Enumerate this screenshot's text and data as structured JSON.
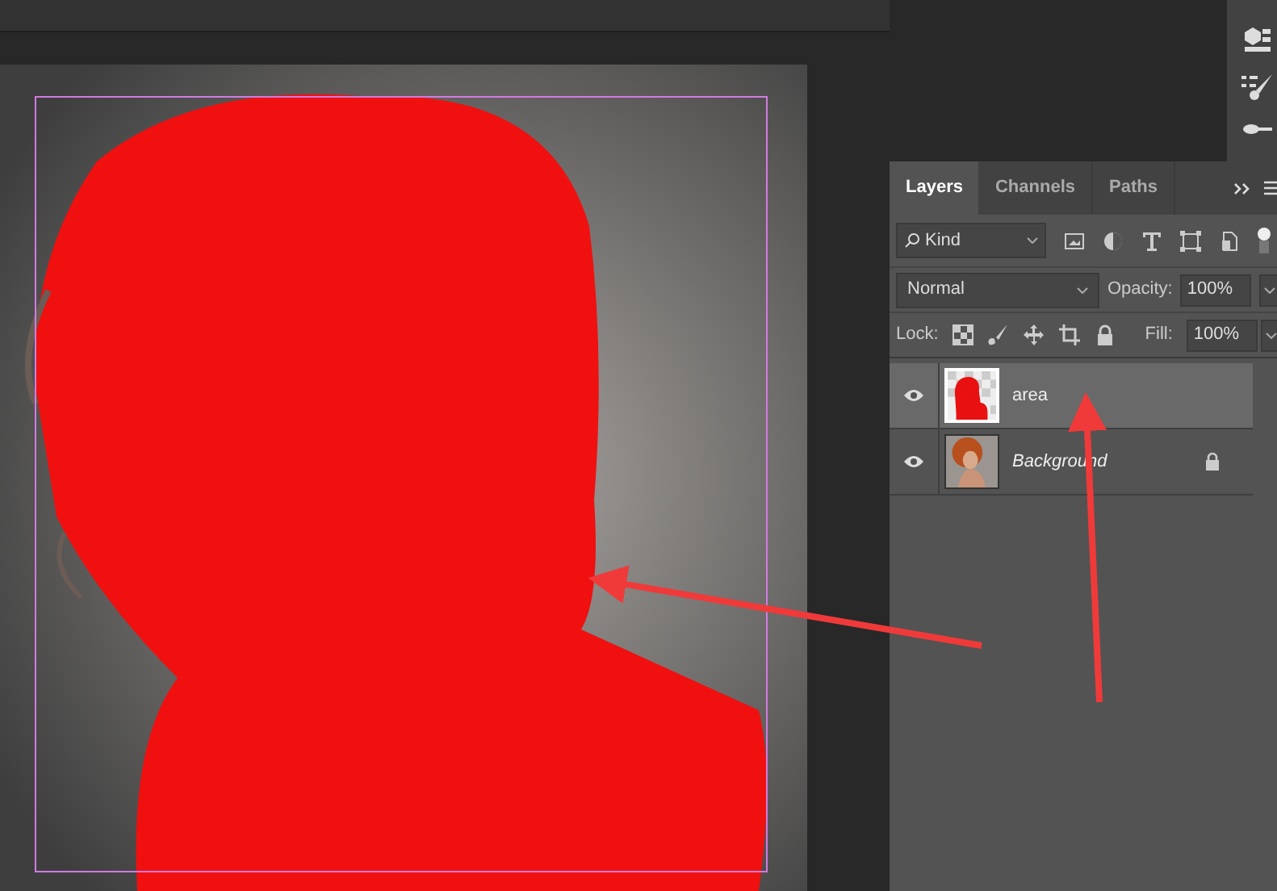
{
  "tabs": [
    {
      "label": "Layers",
      "selected": true
    },
    {
      "label": "Channels",
      "selected": false
    },
    {
      "label": "Paths",
      "selected": false
    }
  ],
  "filter": {
    "value": "Kind"
  },
  "blend_mode": {
    "value": "Normal"
  },
  "opacity": {
    "label": "Opacity:",
    "value": "100%"
  },
  "lock": {
    "label": "Lock:"
  },
  "fill": {
    "label": "Fill:",
    "value": "100%"
  },
  "layers": [
    {
      "name": "area",
      "kind": "mask",
      "selected": true,
      "visible": true,
      "locked": false,
      "italic": false
    },
    {
      "name": "Background",
      "selected": false,
      "visible": true,
      "locked": true,
      "italic": true
    }
  ]
}
